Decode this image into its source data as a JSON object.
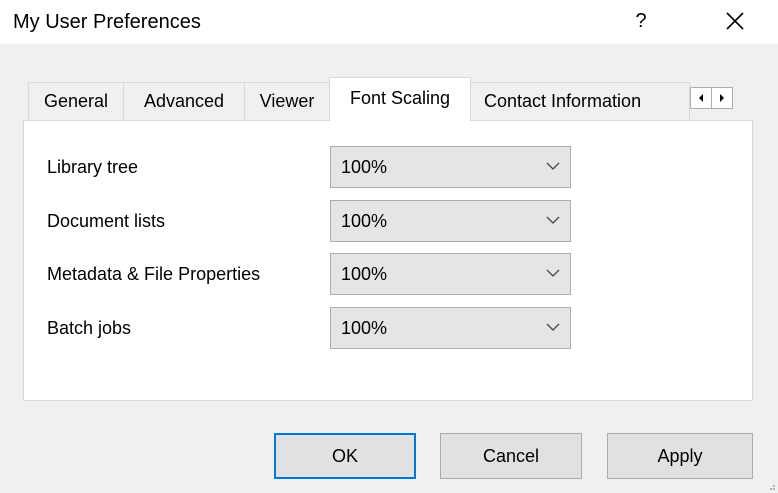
{
  "window": {
    "title": "My User Preferences",
    "help_label": "?",
    "close_icon": "close-icon"
  },
  "tabs": [
    {
      "label": "General",
      "active": false
    },
    {
      "label": "Advanced",
      "active": false
    },
    {
      "label": "Viewer",
      "active": false
    },
    {
      "label": "Font Scaling",
      "active": true
    },
    {
      "label": "Contact Information",
      "active": false
    }
  ],
  "tab_scroll": {
    "left_icon": "triangle-left-icon",
    "right_icon": "triangle-right-icon"
  },
  "settings": [
    {
      "label": "Library tree",
      "value": "100%"
    },
    {
      "label": "Document lists",
      "value": "100%"
    },
    {
      "label": "Metadata & File Properties",
      "value": "100%"
    },
    {
      "label": "Batch jobs",
      "value": "100%"
    }
  ],
  "buttons": {
    "ok": "OK",
    "cancel": "Cancel",
    "apply": "Apply"
  },
  "colors": {
    "accent": "#0078d7",
    "dialog_bg": "#f0f0f0",
    "panel_bg": "#ffffff",
    "combo_bg": "#e5e5e5"
  }
}
